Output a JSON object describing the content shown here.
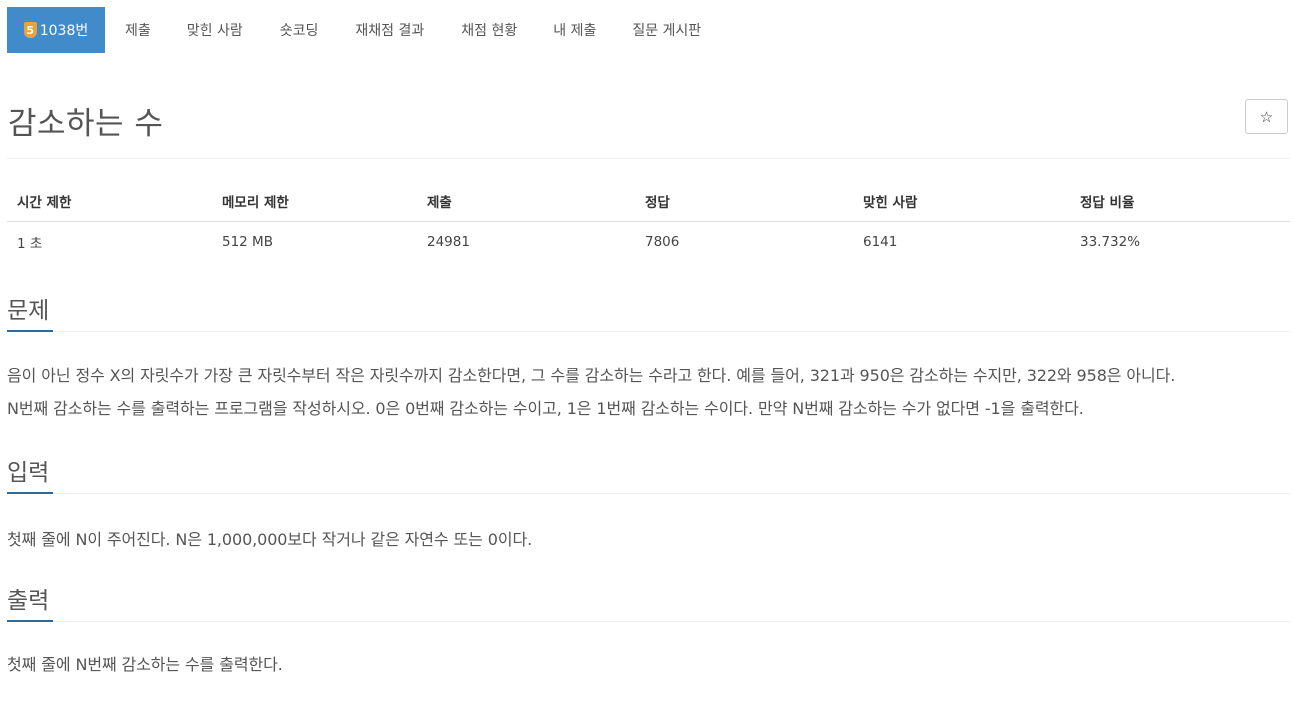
{
  "nav": {
    "tier_icon_text": "5",
    "problem_id": "1038번",
    "items": [
      "제출",
      "맞힌 사람",
      "숏코딩",
      "재채점 결과",
      "채점 현황",
      "내 제출",
      "질문 게시판"
    ]
  },
  "title": "감소하는 수",
  "star": "☆",
  "info": {
    "headers": [
      "시간 제한",
      "메모리 제한",
      "제출",
      "정답",
      "맞힌 사람",
      "정답 비율"
    ],
    "values": [
      "1 초",
      "512 MB",
      "24981",
      "7806",
      "6141",
      "33.732%"
    ]
  },
  "sections": {
    "problem": {
      "heading": "문제",
      "lines": [
        "음이 아닌 정수 X의 자릿수가 가장 큰 자릿수부터 작은 자릿수까지 감소한다면, 그 수를 감소하는 수라고 한다. 예를 들어, 321과 950은 감소하는 수지만, 322와 958은 아니다.",
        "N번째 감소하는 수를 출력하는 프로그램을 작성하시오. 0은 0번째 감소하는 수이고, 1은 1번째 감소하는 수이다. 만약 N번째 감소하는 수가 없다면 -1을 출력한다."
      ]
    },
    "input": {
      "heading": "입력",
      "lines": [
        "첫째 줄에 N이 주어진다. N은 1,000,000보다 작거나 같은 자연수 또는 0이다."
      ]
    },
    "output": {
      "heading": "출력",
      "lines": [
        "첫째 줄에 N번째 감소하는 수를 출력한다."
      ]
    }
  },
  "colors": {
    "nav_active_bg": "#428bca",
    "tier_badge": "#e8a33c",
    "section_accent": "#2b6a9c"
  }
}
